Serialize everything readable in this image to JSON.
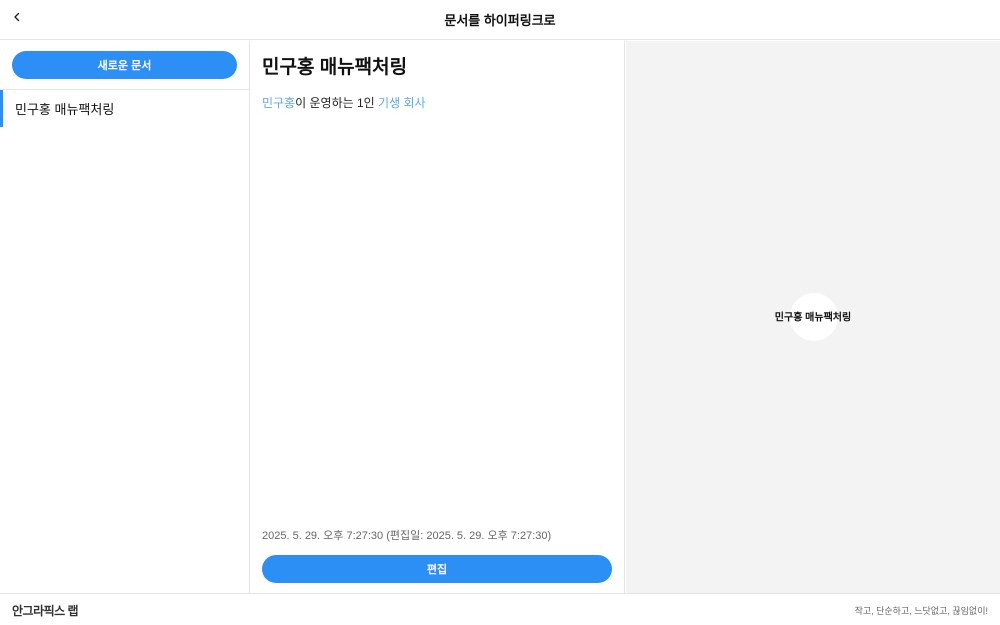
{
  "header": {
    "title": "문서를 하이퍼링크로",
    "back_icon": "chevron-left-icon"
  },
  "sidebar": {
    "new_doc_label": "새로운 문서",
    "items": [
      {
        "label": "민구홍 매뉴팩처링",
        "active": true
      }
    ]
  },
  "document": {
    "title": "민구홍 매뉴팩처링",
    "body": {
      "link1": "민구홍",
      "text1": "이 운영하는 1인 ",
      "link2": "기생 회사"
    },
    "meta": "2025. 5. 29. 오후 7:27:30 (편집일: 2025. 5. 29. 오후 7:27:30)",
    "edit_label": "편집"
  },
  "graph": {
    "nodes": [
      {
        "label": "민구홍 매뉴팩처링"
      }
    ]
  },
  "footer": {
    "logo": "안그라픽스 랩",
    "tagline": "작고, 단순하고, 느닷없고, 끊임없이!"
  },
  "colors": {
    "accent": "#2b8ff6",
    "link": "#5fa8f6",
    "graph_bg": "#f3f3f3"
  }
}
